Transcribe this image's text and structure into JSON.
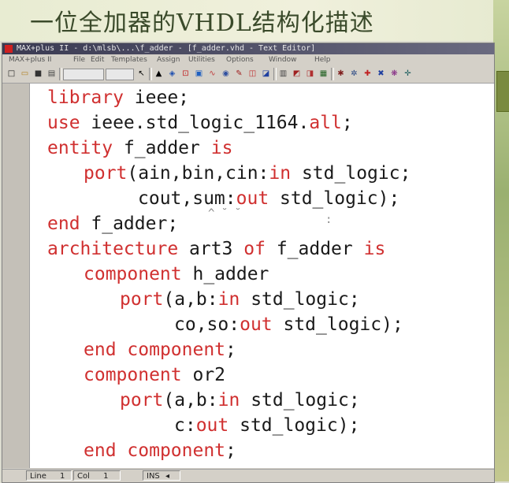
{
  "slide_title": "一位全加器的VHDL结构化描述",
  "window": {
    "title": "MAX+plus II - d:\\mlsb\\...\\f_adder - [f_adder.vhd - Text Editor]",
    "menu": [
      "MAX+plus II",
      "File",
      "Edit",
      "Templates",
      "Assign",
      "Utilities",
      "Options",
      "Window",
      "Help"
    ]
  },
  "toolbar": {
    "icons": [
      "new-icon",
      "open-icon",
      "save-icon",
      "print-icon",
      "font-select",
      "size-select",
      "help-pointer-icon",
      "hierarchy-icon",
      "floorplan-icon",
      "symbol-editor-icon",
      "text-editor-icon",
      "waveform-icon",
      "compiler-icon",
      "simulator-icon",
      "timing-analyzer-icon",
      "programmer-icon",
      "open-project-icon",
      "save-check-icon",
      "save-compile-icon",
      "save-simulate-icon",
      "start-compile-icon",
      "start-sim-icon",
      "tool-a-icon",
      "tool-b-icon",
      "tool-c-icon",
      "tool-d-icon"
    ]
  },
  "code": {
    "keyword_color": "#d03030",
    "lines": [
      {
        "indent": 0,
        "tokens": [
          [
            "library",
            true
          ],
          [
            " ieee;",
            false
          ]
        ]
      },
      {
        "indent": 0,
        "tokens": [
          [
            "use",
            true
          ],
          [
            " ieee.std_logic_1164.",
            false
          ],
          [
            "all",
            true
          ],
          [
            ";",
            false
          ]
        ]
      },
      {
        "indent": 0,
        "tokens": [
          [
            "entity",
            true
          ],
          [
            " f_adder ",
            false
          ],
          [
            "is",
            true
          ]
        ]
      },
      {
        "indent": 2,
        "tokens": [
          [
            "port",
            true
          ],
          [
            "(ain,bin,cin:",
            false
          ],
          [
            "in",
            true
          ],
          [
            " std_logic;",
            false
          ]
        ]
      },
      {
        "indent": 5,
        "tokens": [
          [
            "cout,sum:",
            false
          ],
          [
            "out",
            true
          ],
          [
            " std_logic);",
            false
          ]
        ]
      },
      {
        "indent": 0,
        "tokens": [
          [
            "end",
            true
          ],
          [
            " f_adder;",
            false
          ]
        ]
      },
      {
        "indent": 0,
        "tokens": [
          [
            "architecture",
            true
          ],
          [
            " art3 ",
            false
          ],
          [
            "of",
            true
          ],
          [
            " f_adder ",
            false
          ],
          [
            "is",
            true
          ]
        ]
      },
      {
        "indent": 2,
        "tokens": [
          [
            "component",
            true
          ],
          [
            " h_adder",
            false
          ]
        ]
      },
      {
        "indent": 4,
        "tokens": [
          [
            "port",
            true
          ],
          [
            "(a,b:",
            false
          ],
          [
            "in",
            true
          ],
          [
            " std_logic;",
            false
          ]
        ]
      },
      {
        "indent": 7,
        "tokens": [
          [
            "co,so:",
            false
          ],
          [
            "out",
            true
          ],
          [
            " std_logic);",
            false
          ]
        ]
      },
      {
        "indent": 2,
        "tokens": [
          [
            "end",
            true
          ],
          [
            " ",
            false
          ],
          [
            "component",
            true
          ],
          [
            ";",
            false
          ]
        ]
      },
      {
        "indent": 2,
        "tokens": [
          [
            "component",
            true
          ],
          [
            " or2",
            false
          ]
        ]
      },
      {
        "indent": 4,
        "tokens": [
          [
            "port",
            true
          ],
          [
            "(a,b:",
            false
          ],
          [
            "in",
            true
          ],
          [
            " std_logic;",
            false
          ]
        ]
      },
      {
        "indent": 7,
        "tokens": [
          [
            "c:",
            false
          ],
          [
            "out",
            true
          ],
          [
            " std_logic);",
            false
          ]
        ]
      },
      {
        "indent": 2,
        "tokens": [
          [
            "end",
            true
          ],
          [
            " ",
            false
          ],
          [
            "component",
            true
          ],
          [
            ";",
            false
          ]
        ]
      }
    ]
  },
  "statusbar": {
    "line_label": "Line",
    "line_value": "1",
    "col_label": "Col",
    "col_value": "1",
    "mode": "INS"
  }
}
